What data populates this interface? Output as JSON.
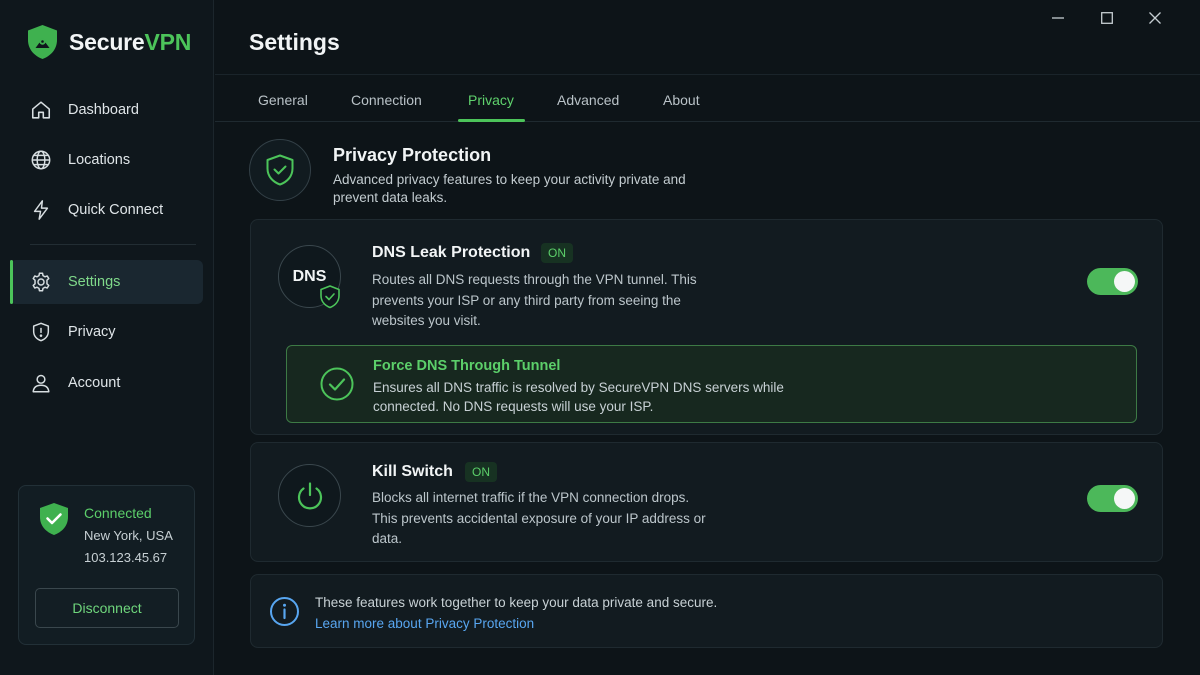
{
  "app": {
    "brand_main": "Secure",
    "brand_accent": "VPN"
  },
  "colors": {
    "accent": "#4cc45a",
    "background": "#0d1418",
    "link": "#58a6f0"
  },
  "window_controls": [
    "minimize-icon",
    "maximize-icon",
    "close-icon"
  ],
  "sidebar": {
    "items": [
      {
        "label": "Dashboard",
        "icon": "home-icon"
      },
      {
        "label": "Locations",
        "icon": "globe-icon"
      },
      {
        "label": "Quick Connect",
        "icon": "lightning-icon"
      },
      {
        "label": "Settings",
        "icon": "gear-icon",
        "active": true
      },
      {
        "label": "Privacy",
        "icon": "shield-icon"
      },
      {
        "label": "Account",
        "icon": "user-icon"
      }
    ],
    "status": {
      "title": "Connected",
      "location": "New York, USA",
      "ip": "103.123.45.67",
      "disconnect_label": "Disconnect"
    }
  },
  "header": {
    "title": "Settings"
  },
  "tabs": [
    {
      "label": "General"
    },
    {
      "label": "Connection"
    },
    {
      "label": "Privacy",
      "active": true
    },
    {
      "label": "Advanced"
    },
    {
      "label": "About"
    }
  ],
  "privacy": {
    "title": "Privacy Protection",
    "description": "Advanced privacy features to keep your activity private and prevent data leaks.",
    "dns": {
      "icon_text": "DNS",
      "title": "DNS Leak Protection",
      "badge": "ON",
      "description": "Routes all DNS requests through the VPN tunnel. This prevents your ISP or any third party from seeing the websites you visit.",
      "enabled": true,
      "force": {
        "title": "Force DNS Through Tunnel",
        "description": "Ensures all DNS traffic is resolved by SecureVPN DNS servers while connected. No DNS requests will use your ISP."
      }
    },
    "kill_switch": {
      "title": "Kill Switch",
      "badge": "ON",
      "description": "Blocks all internet traffic if the VPN connection drops. This prevents accidental exposure of your IP address or data.",
      "enabled": true
    },
    "info": {
      "text": "These features work together to keep your data private and secure.",
      "link": "Learn more about Privacy Protection"
    }
  }
}
